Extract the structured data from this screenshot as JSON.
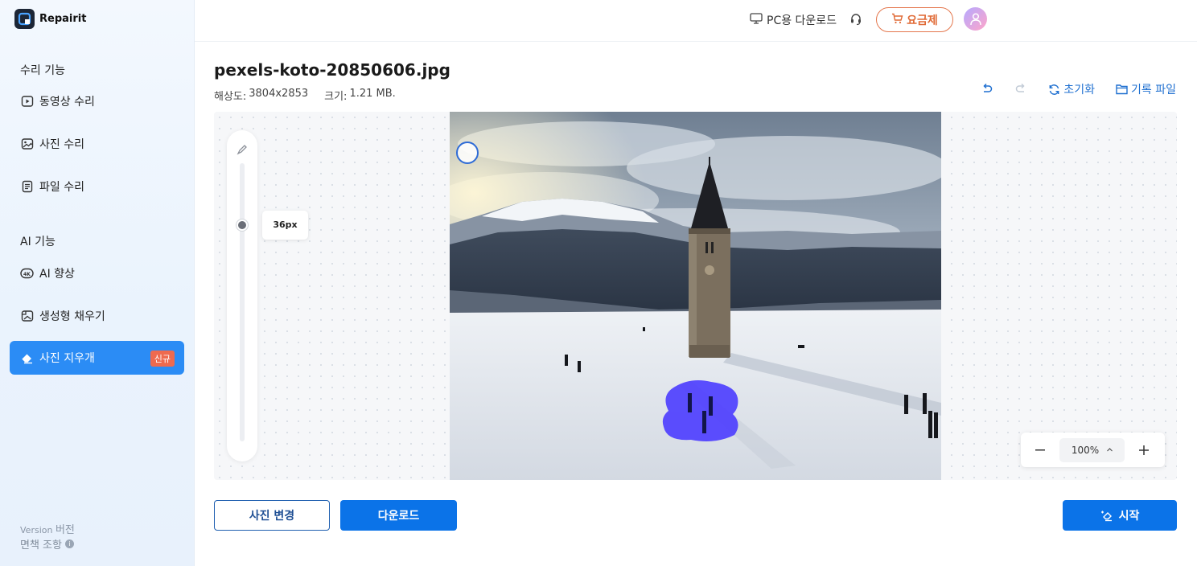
{
  "app": {
    "name": "Repairit"
  },
  "sidebar": {
    "section_repair": "수리 기능",
    "section_ai": "AI 기능",
    "items": [
      {
        "label": "동영상 수리",
        "icon": "video-icon"
      },
      {
        "label": "사진 수리",
        "icon": "image-icon"
      },
      {
        "label": "파일 수리",
        "icon": "file-icon"
      },
      {
        "label": "AI 향상",
        "icon": "ai-enhance-icon"
      },
      {
        "label": "생성형 채우기",
        "icon": "generative-fill-icon"
      },
      {
        "label": "사진 지우개",
        "icon": "eraser-icon",
        "badge": "신규",
        "active": true
      }
    ],
    "version_label": "Version",
    "version_text": "버전",
    "disclaimer": "면책 조항"
  },
  "topbar": {
    "pc_download": "PC용 다운로드",
    "pricing": "요금제"
  },
  "file": {
    "name": "pexels-koto-20850606.jpg",
    "resolution_label": "해상도:",
    "resolution": "3804x2853",
    "size_label": "크기:",
    "size": "1.21 MB."
  },
  "toolbar": {
    "reset": "초기화",
    "history": "기록 파일"
  },
  "brush": {
    "size_label": "36px",
    "level": 0.21
  },
  "zoom": {
    "value": "100%"
  },
  "buttons": {
    "change_photo": "사진 변경",
    "download": "다운로드",
    "start": "시작"
  },
  "colors": {
    "accent": "#0b73e8",
    "active_nav": "#2b8cf5",
    "badge": "#ee6a4f",
    "pricing": "#e06a36",
    "mask": "#4b3cff"
  }
}
